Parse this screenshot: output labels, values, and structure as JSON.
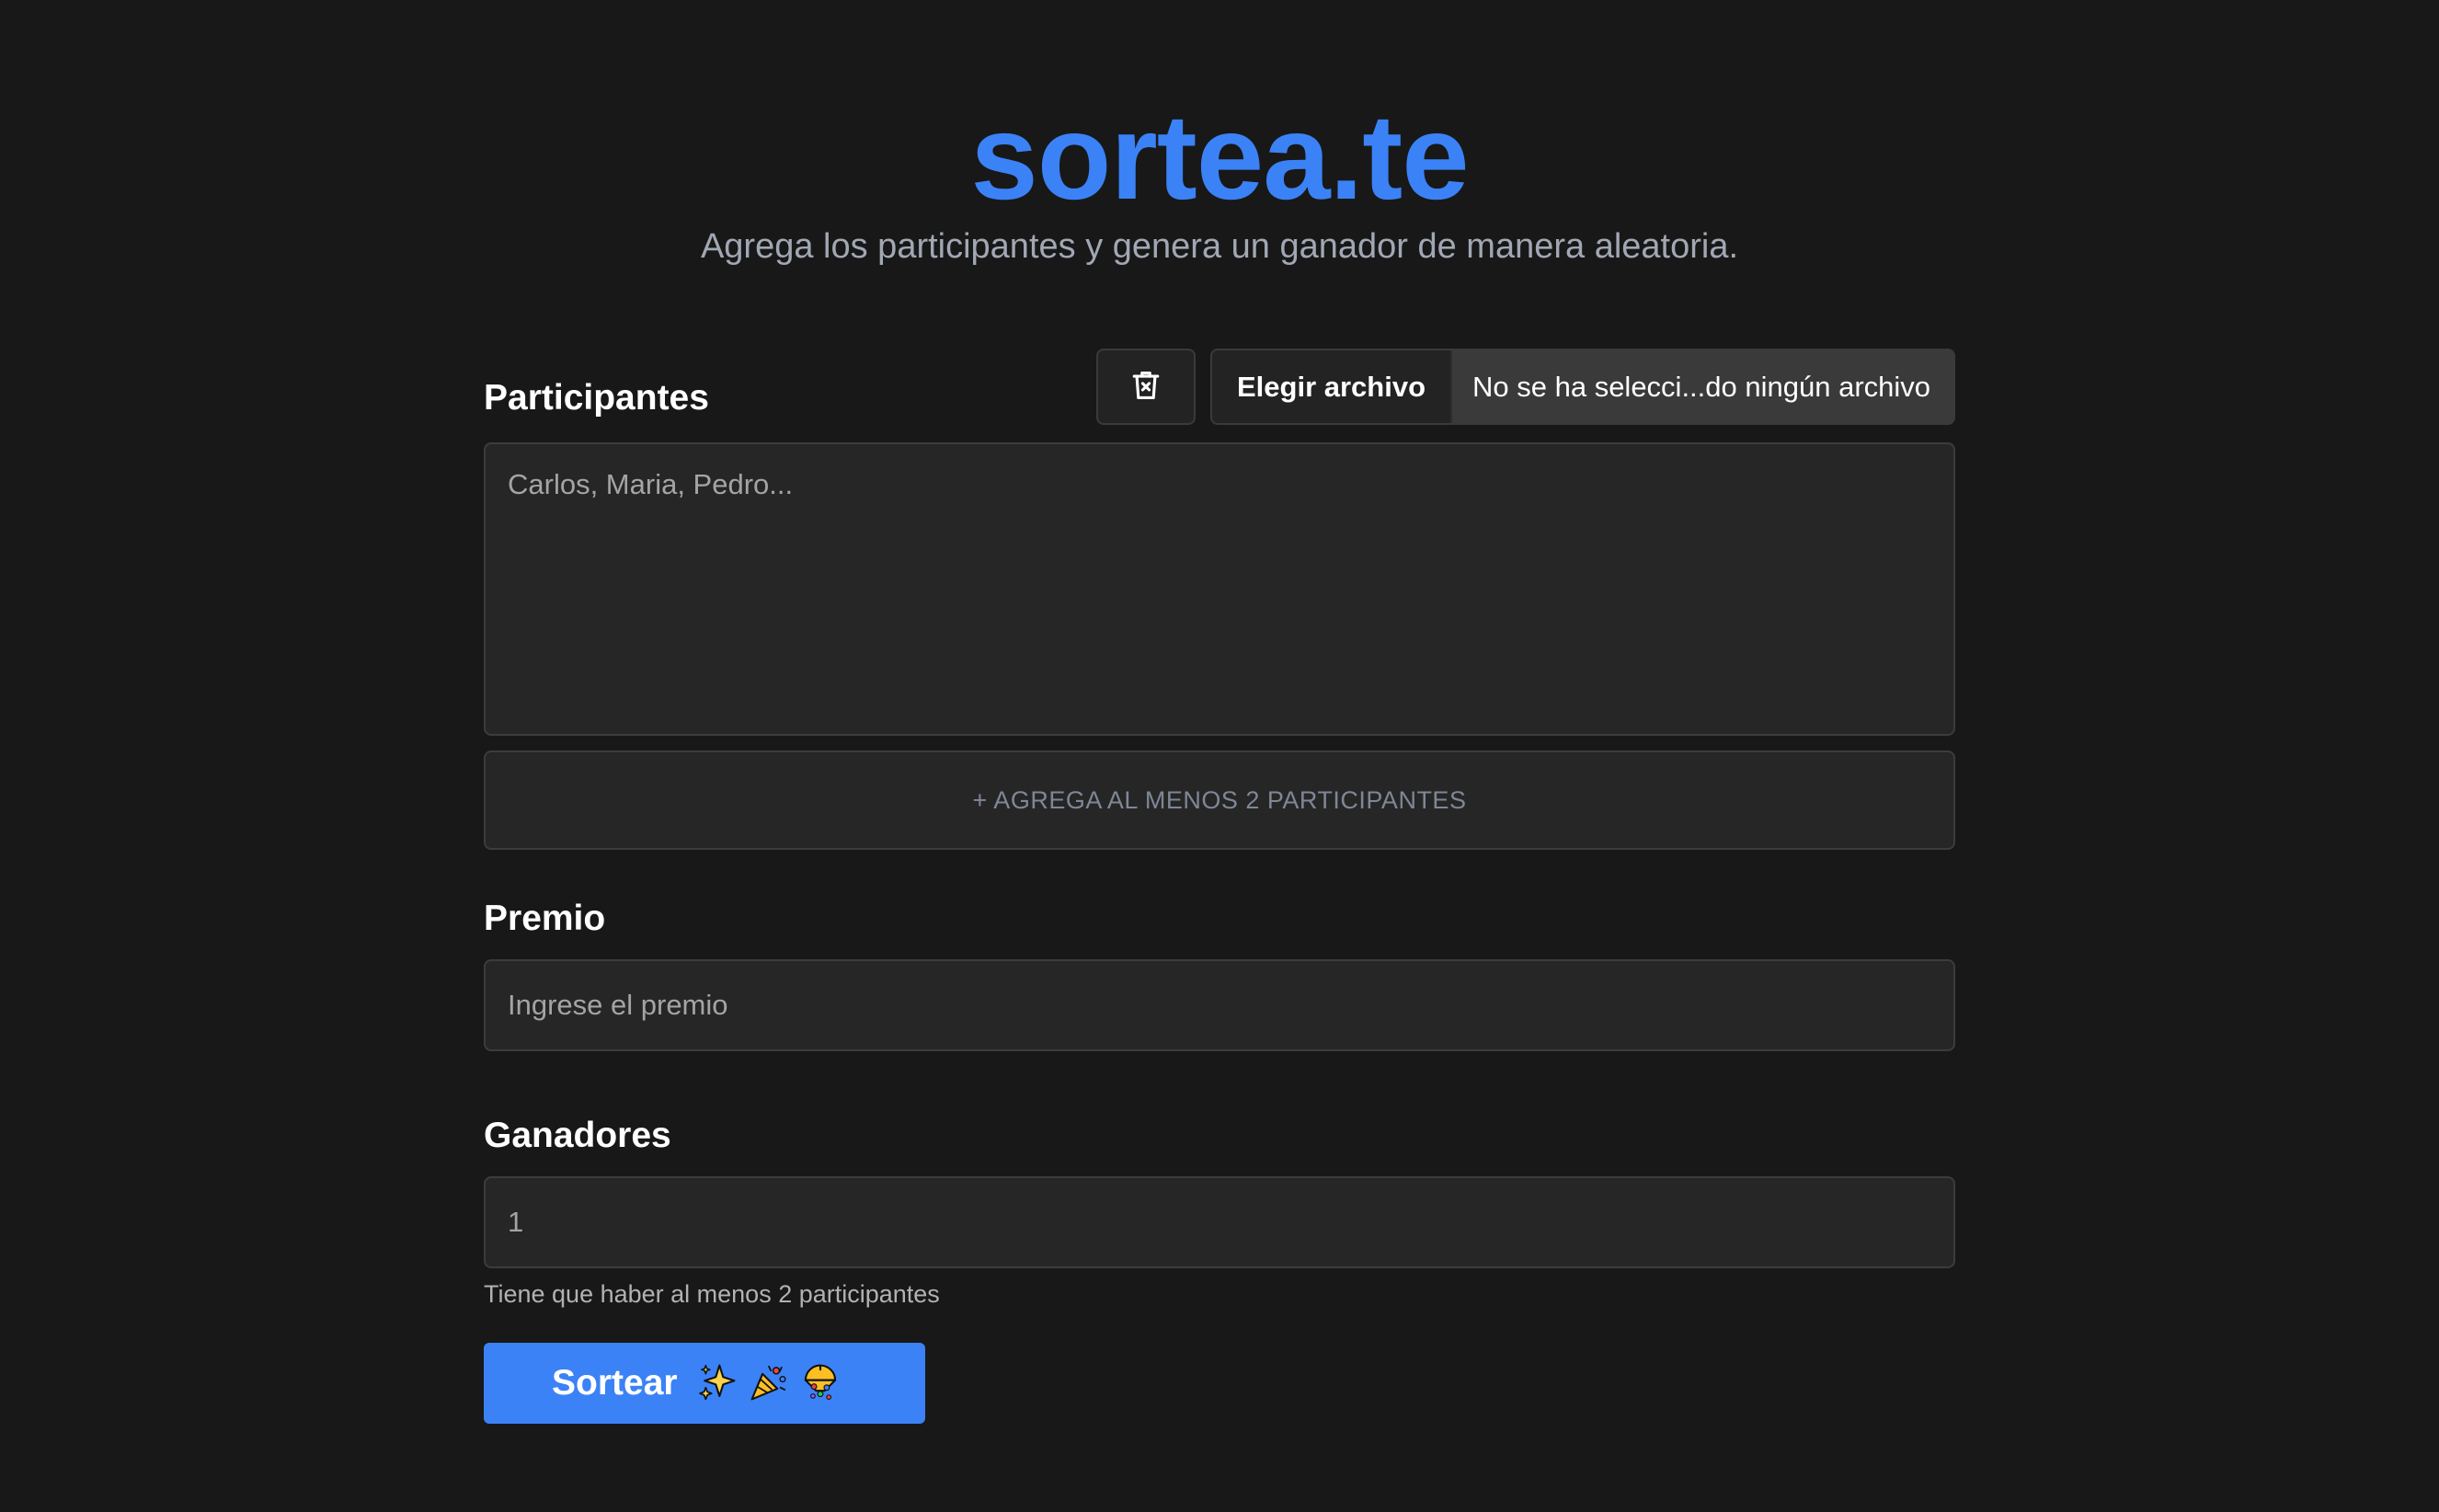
{
  "header": {
    "logo": "sortea.te",
    "subtitle": "Agrega los participantes y genera un ganador de manera aleatoria."
  },
  "participants": {
    "label": "Participantes",
    "clear_icon": "trash-icon",
    "file_button_label": "Elegir archivo",
    "file_status": "No se ha selecci...do ningún archivo",
    "placeholder": "Carlos, Maria, Pedro...",
    "add_message": "+ AGREGA AL MENOS 2 PARTICIPANTES"
  },
  "prize": {
    "label": "Premio",
    "placeholder": "Ingrese el premio"
  },
  "winners": {
    "label": "Ganadores",
    "placeholder": "1",
    "hint": "Tiene que haber al menos 2 participantes"
  },
  "submit": {
    "label": "Sortear",
    "icons": [
      "sparkles-icon",
      "party-popper-icon",
      "confetti-ball-icon"
    ]
  },
  "colors": {
    "accent": "#3b82f6",
    "background": "#181818",
    "field": "#262626"
  }
}
